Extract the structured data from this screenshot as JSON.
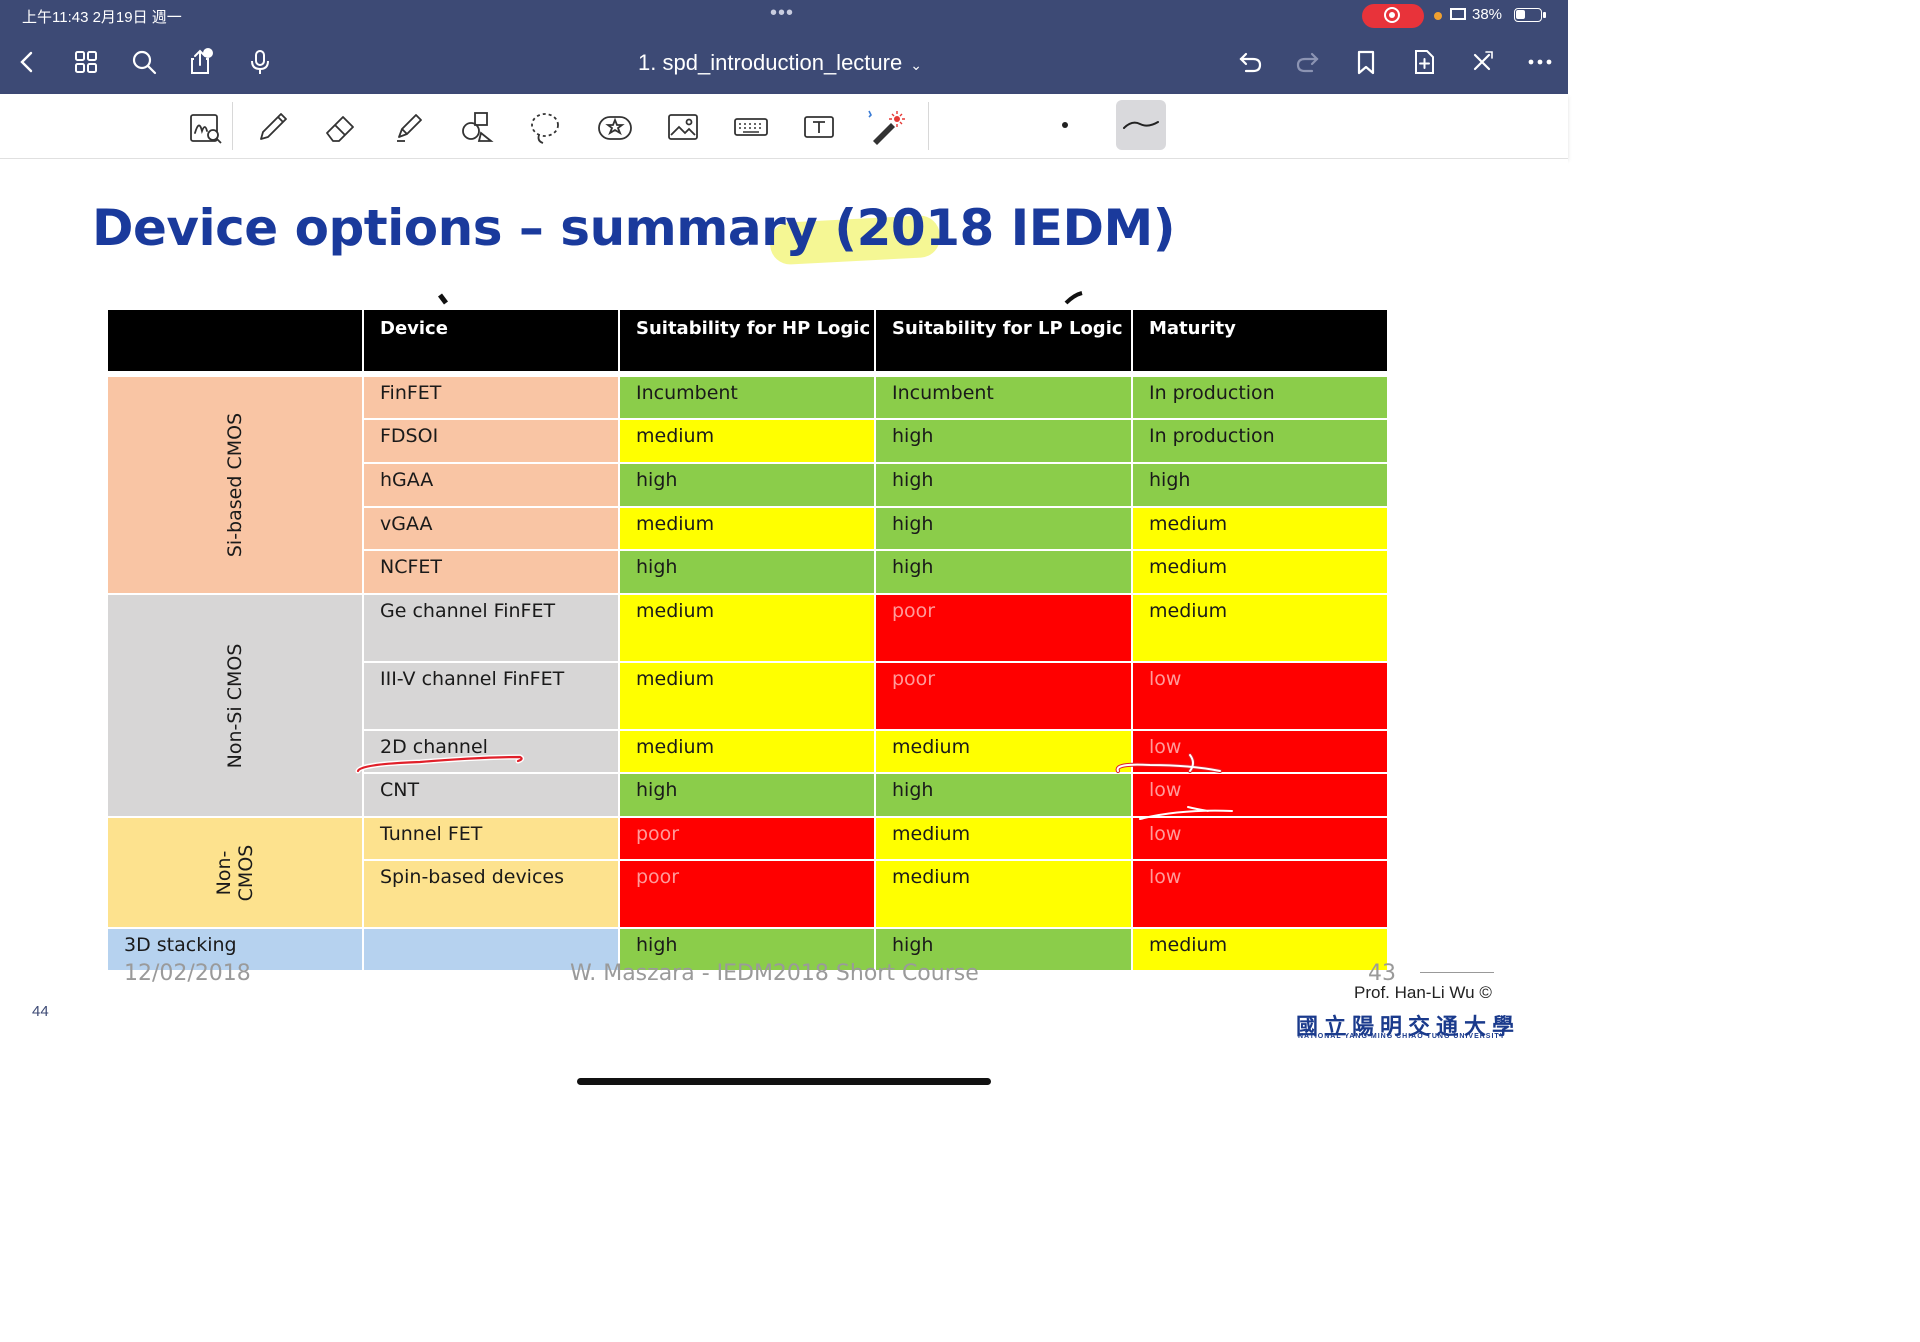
{
  "status_bar": {
    "time": "上午11:43  2月19日 週一",
    "dots": "•••",
    "battery_pct": "38%",
    "battery_level": 0.38
  },
  "nav": {
    "document_title": "1. spd_introduction_lecture",
    "title_chevron": "⌄",
    "left_icons": [
      "back-icon",
      "grid-icon",
      "search-icon",
      "share-icon",
      "microphone-icon"
    ],
    "right_icons": [
      "undo-icon",
      "redo-icon",
      "bookmark-icon",
      "add-page-icon",
      "close-icon",
      "more-icon"
    ]
  },
  "toolbar": {
    "tools": [
      "handwriting-zoom-icon",
      "pen-icon",
      "eraser-icon",
      "highlighter-icon",
      "shapes-icon",
      "lasso-icon",
      "sticker-icon",
      "image-icon",
      "keyboard-icon",
      "text-box-icon",
      "laser-pointer-icon"
    ]
  },
  "slide": {
    "title": "Device options – summary (2018 IEDM)",
    "table": {
      "headers": [
        "",
        "Device",
        "Suitability for HP Logic",
        "Suitability for LP Logic",
        "Maturity"
      ],
      "groups": [
        {
          "label": "Si-based CMOS",
          "rows": [
            {
              "device": "FinFET",
              "hp": "Incumbent",
              "lp": "Incumbent",
              "maturity": "In production"
            },
            {
              "device": "FDSOI",
              "hp": "medium",
              "lp": "high",
              "maturity": "In production"
            },
            {
              "device": "hGAA",
              "hp": "high",
              "lp": "high",
              "maturity": "high"
            },
            {
              "device": "vGAA",
              "hp": "medium",
              "lp": "high",
              "maturity": "medium"
            },
            {
              "device": "NCFET",
              "hp": "high",
              "lp": "high",
              "maturity": "medium"
            }
          ]
        },
        {
          "label": "Non-Si CMOS",
          "rows": [
            {
              "device": "Ge channel FinFET",
              "hp": "medium",
              "lp": "poor",
              "maturity": "medium"
            },
            {
              "device": "III-V channel FinFET",
              "hp": "medium",
              "lp": "poor",
              "maturity": "low"
            },
            {
              "device": "2D channel",
              "hp": "medium",
              "lp": "medium",
              "maturity": "low"
            },
            {
              "device": "CNT",
              "hp": "high",
              "lp": "high",
              "maturity": "low"
            }
          ]
        },
        {
          "label_line1": "Non-",
          "label_line2": "CMOS",
          "rows": [
            {
              "device": "Tunnel FET",
              "hp": "poor",
              "lp": "medium",
              "maturity": "low"
            },
            {
              "device": "Spin-based devices",
              "hp": "poor",
              "lp": "medium",
              "maturity": "low"
            }
          ]
        }
      ],
      "last_row": {
        "label": "3D stacking",
        "device": "",
        "hp": "high",
        "lp": "high",
        "maturity": "medium"
      }
    },
    "footer_date": "12/02/2018",
    "footer_source": "W. Maszara - IEDM2018 Short Course",
    "footer_slide_number": "43",
    "page_number": "44",
    "credit": "Prof. Han-Li Wu ©",
    "university_zh": "國立陽明交通大學",
    "university_en": "NATIONAL YANG MING CHIAO TUNG UNIVERSITY"
  },
  "colors": {
    "nav_bg": "#3d4a75",
    "title_blue": "#1a3a9c",
    "green": "#8bcd4a",
    "yellow": "#ffff00",
    "red": "#ff0000",
    "si_group": "#f9c5a4",
    "non_si_group": "#d7d6d6",
    "non_cmos_group": "#fde28e",
    "stacking": "#b6d2ef",
    "recording": "#e8333a"
  }
}
